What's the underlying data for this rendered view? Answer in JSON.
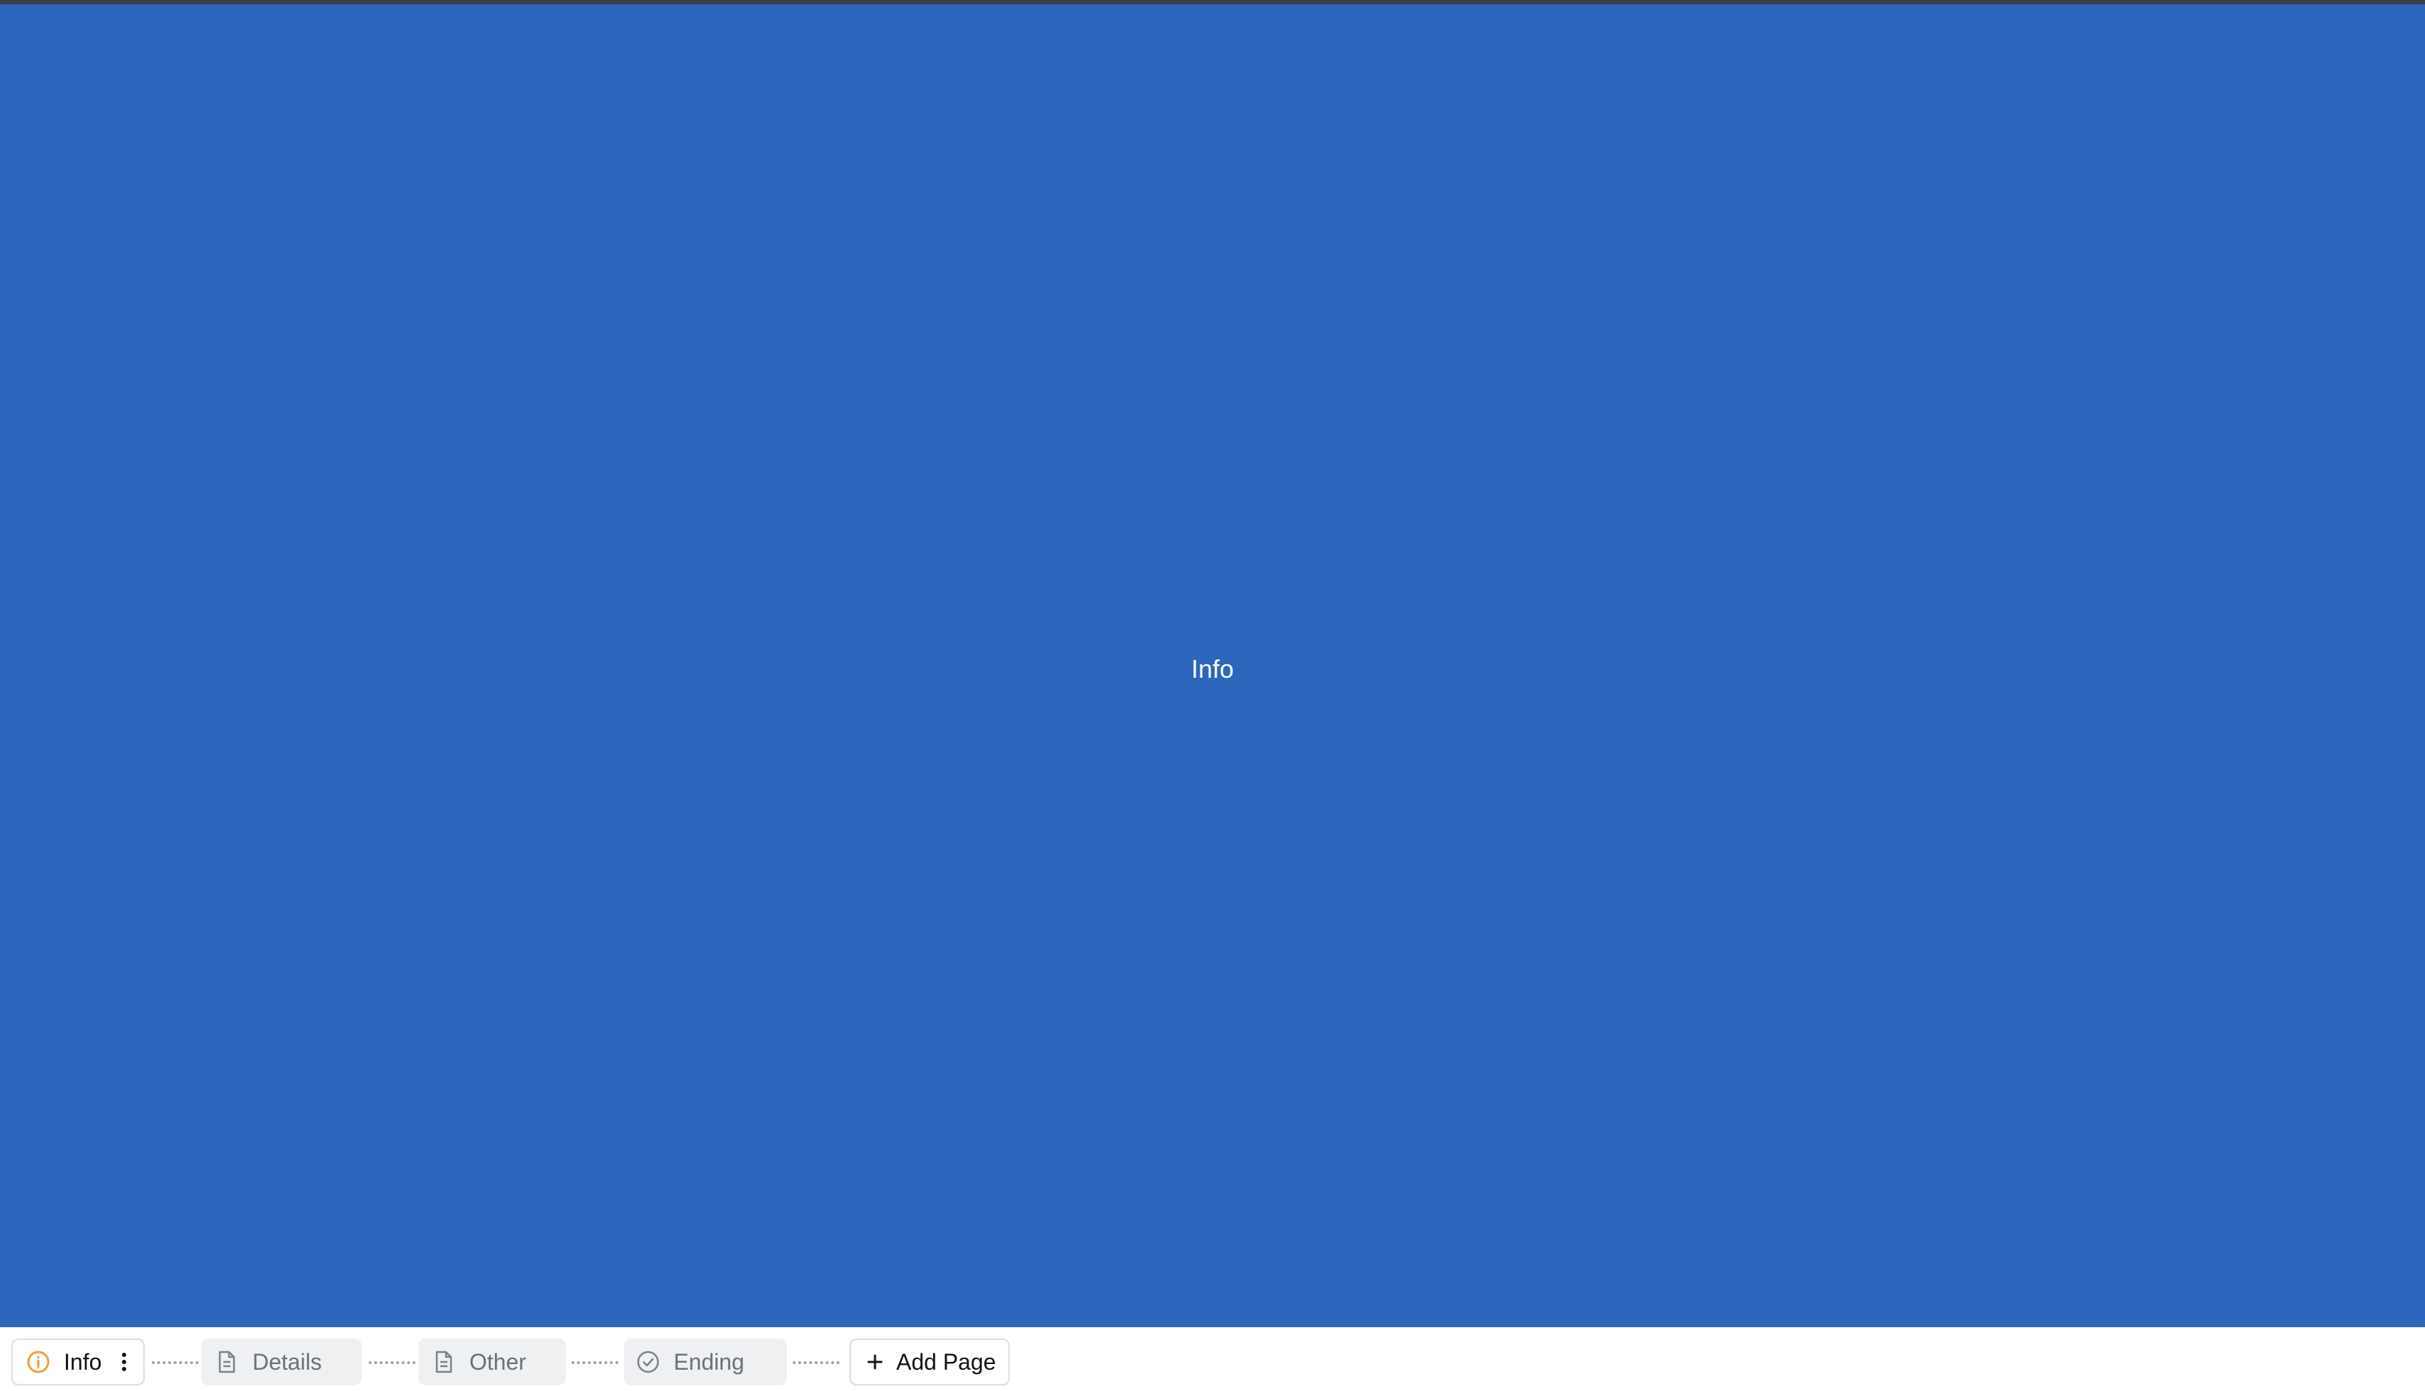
{
  "canvas": {
    "title": "Info",
    "background_color": "#2d66bd"
  },
  "pages": [
    {
      "label": "Info",
      "icon": "info-circle-icon",
      "active": true,
      "icon_color": "#e8a13a"
    },
    {
      "label": "Details",
      "icon": "document-icon",
      "active": false
    },
    {
      "label": "Other",
      "icon": "document-icon",
      "active": false
    },
    {
      "label": "Ending",
      "icon": "check-circle-icon",
      "active": false
    }
  ],
  "add_page": {
    "label": "Add Page",
    "icon": "plus-icon"
  }
}
